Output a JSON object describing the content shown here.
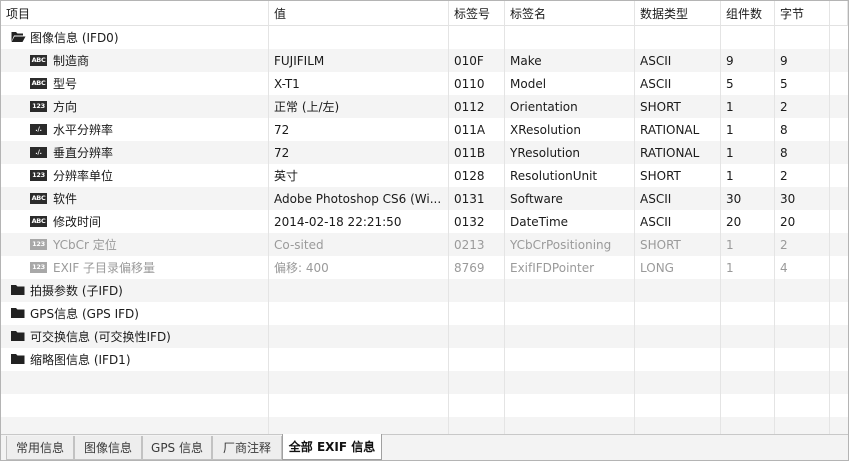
{
  "columns": [
    "项目",
    "值",
    "标签号",
    "标签名",
    "数据类型",
    "组件数",
    "字节"
  ],
  "image_group": {
    "label": "图像信息 (IFD0)",
    "icon": "folder-open-icon"
  },
  "rows": [
    {
      "badge": "ABC",
      "name": "制造商",
      "value": "FUJIFILM",
      "tag": "010F",
      "tagname": "Make",
      "type": "ASCII",
      "count": "9",
      "bytes": "9",
      "dim": false
    },
    {
      "badge": "ABC",
      "name": "型号",
      "value": "X-T1",
      "tag": "0110",
      "tagname": "Model",
      "type": "ASCII",
      "count": "5",
      "bytes": "5",
      "dim": false
    },
    {
      "badge": "123",
      "name": "方向",
      "value": "正常 (上/左)",
      "tag": "0112",
      "tagname": "Orientation",
      "type": "SHORT",
      "count": "1",
      "bytes": "2",
      "dim": false
    },
    {
      "badge": "./.",
      "name": "水平分辨率",
      "value": "72",
      "tag": "011A",
      "tagname": "XResolution",
      "type": "RATIONAL",
      "count": "1",
      "bytes": "8",
      "dim": false
    },
    {
      "badge": "./.",
      "name": "垂直分辨率",
      "value": "72",
      "tag": "011B",
      "tagname": "YResolution",
      "type": "RATIONAL",
      "count": "1",
      "bytes": "8",
      "dim": false
    },
    {
      "badge": "123",
      "name": "分辨率单位",
      "value": "英寸",
      "tag": "0128",
      "tagname": "ResolutionUnit",
      "type": "SHORT",
      "count": "1",
      "bytes": "2",
      "dim": false
    },
    {
      "badge": "ABC",
      "name": "软件",
      "value": "Adobe Photoshop CS6 (Wi...",
      "tag": "0131",
      "tagname": "Software",
      "type": "ASCII",
      "count": "30",
      "bytes": "30",
      "dim": false
    },
    {
      "badge": "ABC",
      "name": "修改时间",
      "value": "2014-02-18 22:21:50",
      "tag": "0132",
      "tagname": "DateTime",
      "type": "ASCII",
      "count": "20",
      "bytes": "20",
      "dim": false
    },
    {
      "badge": "123",
      "name": "YCbCr 定位",
      "value": "Co-sited",
      "tag": "0213",
      "tagname": "YCbCrPositioning",
      "type": "SHORT",
      "count": "1",
      "bytes": "2",
      "dim": true
    },
    {
      "badge": "123",
      "name": "EXIF 子目录偏移量",
      "value": "偏移: 400",
      "tag": "8769",
      "tagname": "ExifIFDPointer",
      "type": "LONG",
      "count": "1",
      "bytes": "4",
      "dim": true
    }
  ],
  "groups": [
    {
      "label": "拍摄参数 (子IFD)",
      "icon": "folder-icon"
    },
    {
      "label": "GPS信息 (GPS IFD)",
      "icon": "folder-icon"
    },
    {
      "label": "可交换信息 (可交换性IFD)",
      "icon": "folder-icon"
    },
    {
      "label": "缩略图信息 (IFD1)",
      "icon": "folder-icon"
    }
  ],
  "tabs": [
    {
      "label": "常用信息",
      "active": false
    },
    {
      "label": "图像信息",
      "active": false
    },
    {
      "label": "GPS 信息",
      "active": false
    },
    {
      "label": "厂商注释",
      "active": false
    },
    {
      "label": "全部 EXIF 信息",
      "active": true
    }
  ]
}
